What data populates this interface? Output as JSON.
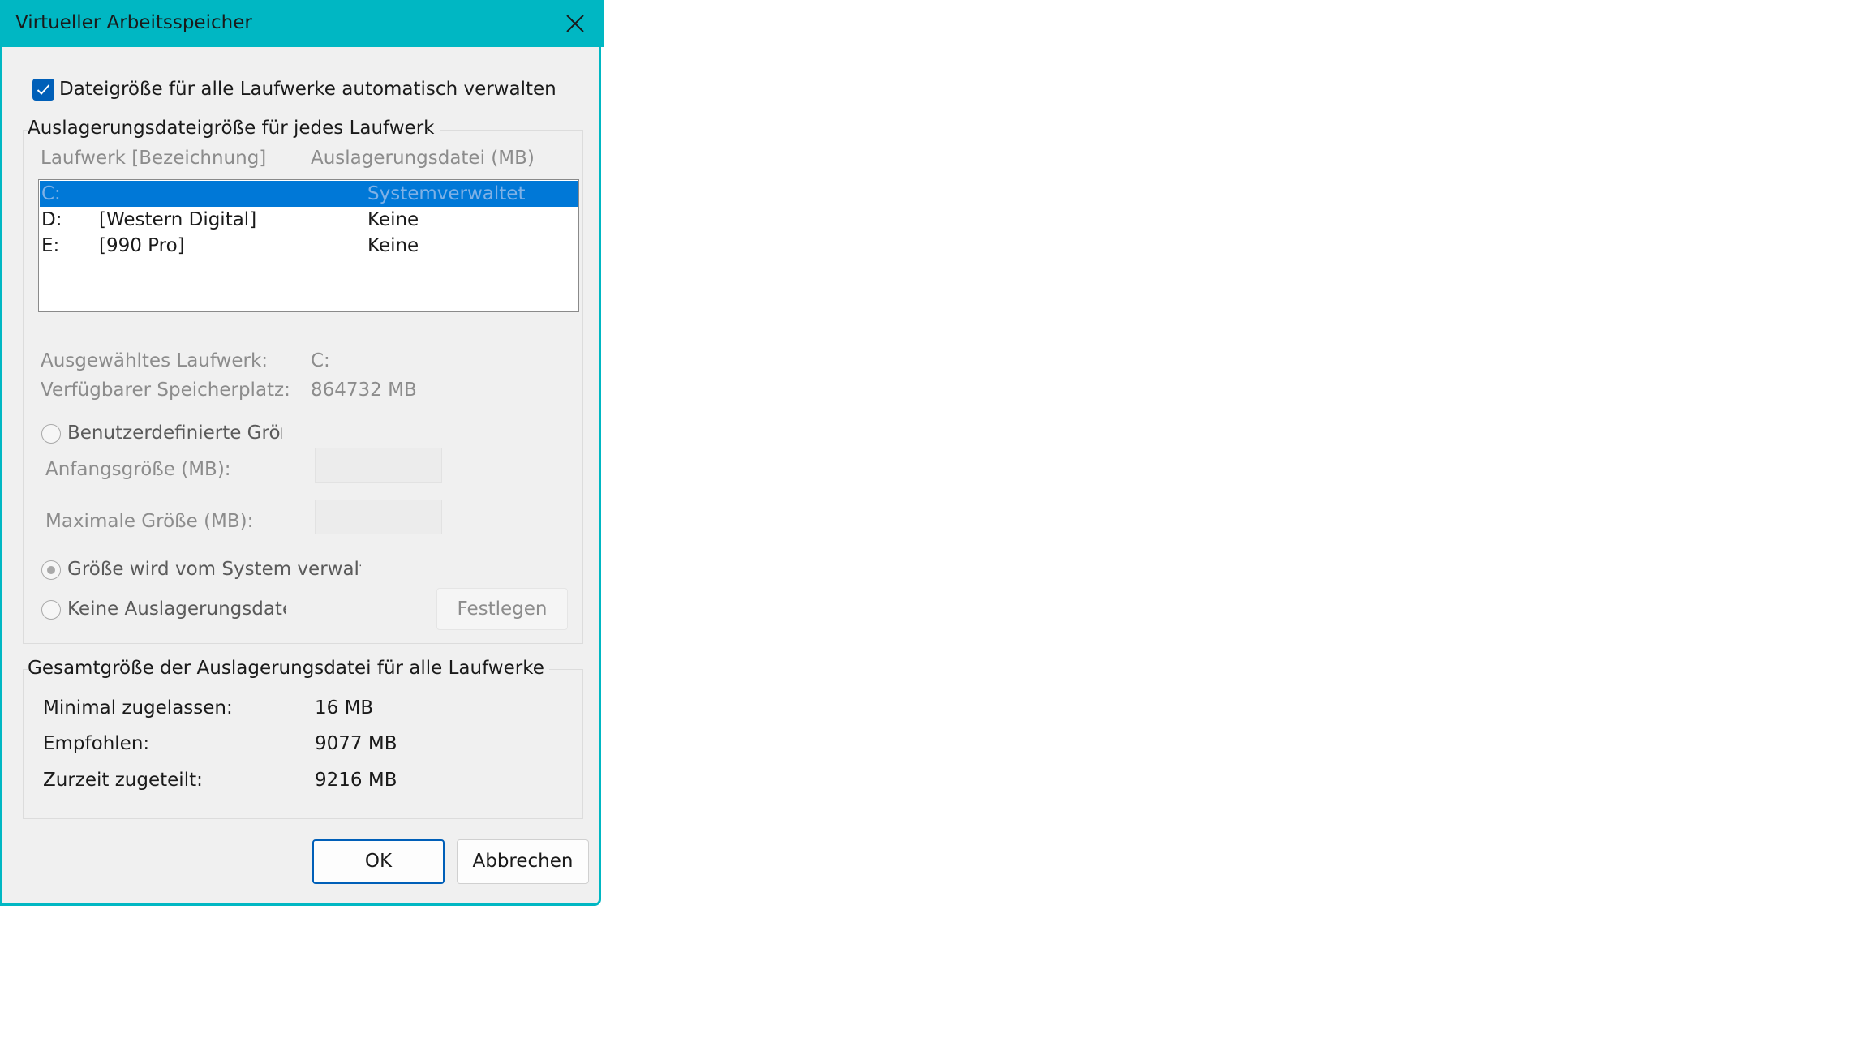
{
  "dialog": {
    "title": "Virtueller Arbeitsspeicher",
    "accent_color": "#00b7c3"
  },
  "auto_manage": {
    "label": "Dateigröße für alle Laufwerke automatisch verwalten",
    "checked": true
  },
  "drives_group": {
    "legend": "Auslagerungsdateigröße für jedes Laufwerk",
    "col_drive": "Laufwerk [Bezeichnung]",
    "col_pagefile": "Auslagerungsdatei (MB)",
    "rows": [
      {
        "drive": "C:",
        "label": "",
        "pagefile": "Systemverwaltet",
        "selected": true
      },
      {
        "drive": "D:",
        "label": "[Western Digital]",
        "pagefile": "Keine",
        "selected": false
      },
      {
        "drive": "E:",
        "label": "[990 Pro]",
        "pagefile": "Keine",
        "selected": false
      }
    ],
    "selected_drive_label": "Ausgewähltes Laufwerk:",
    "selected_drive_value": "C:",
    "free_space_label": "Verfügbarer Speicherplatz:",
    "free_space_value": "864732 MB",
    "custom_size_label": "Benutzerdefinierte Größe",
    "initial_size_label": "Anfangsgröße (MB):",
    "max_size_label": "Maximale Größe (MB):",
    "system_managed_label": "Größe wird vom System verwaltet",
    "no_pagefile_label": "Keine Auslagerungsdatei",
    "set_button": "Festlegen"
  },
  "totals_group": {
    "legend": "Gesamtgröße der Auslagerungsdatei für alle Laufwerke",
    "min_label": "Minimal zugelassen:",
    "min_value": "16 MB",
    "recommended_label": "Empfohlen:",
    "recommended_value": "9077 MB",
    "current_label": "Zurzeit zugeteilt:",
    "current_value": "9216 MB"
  },
  "buttons": {
    "ok": "OK",
    "cancel": "Abbrechen"
  }
}
